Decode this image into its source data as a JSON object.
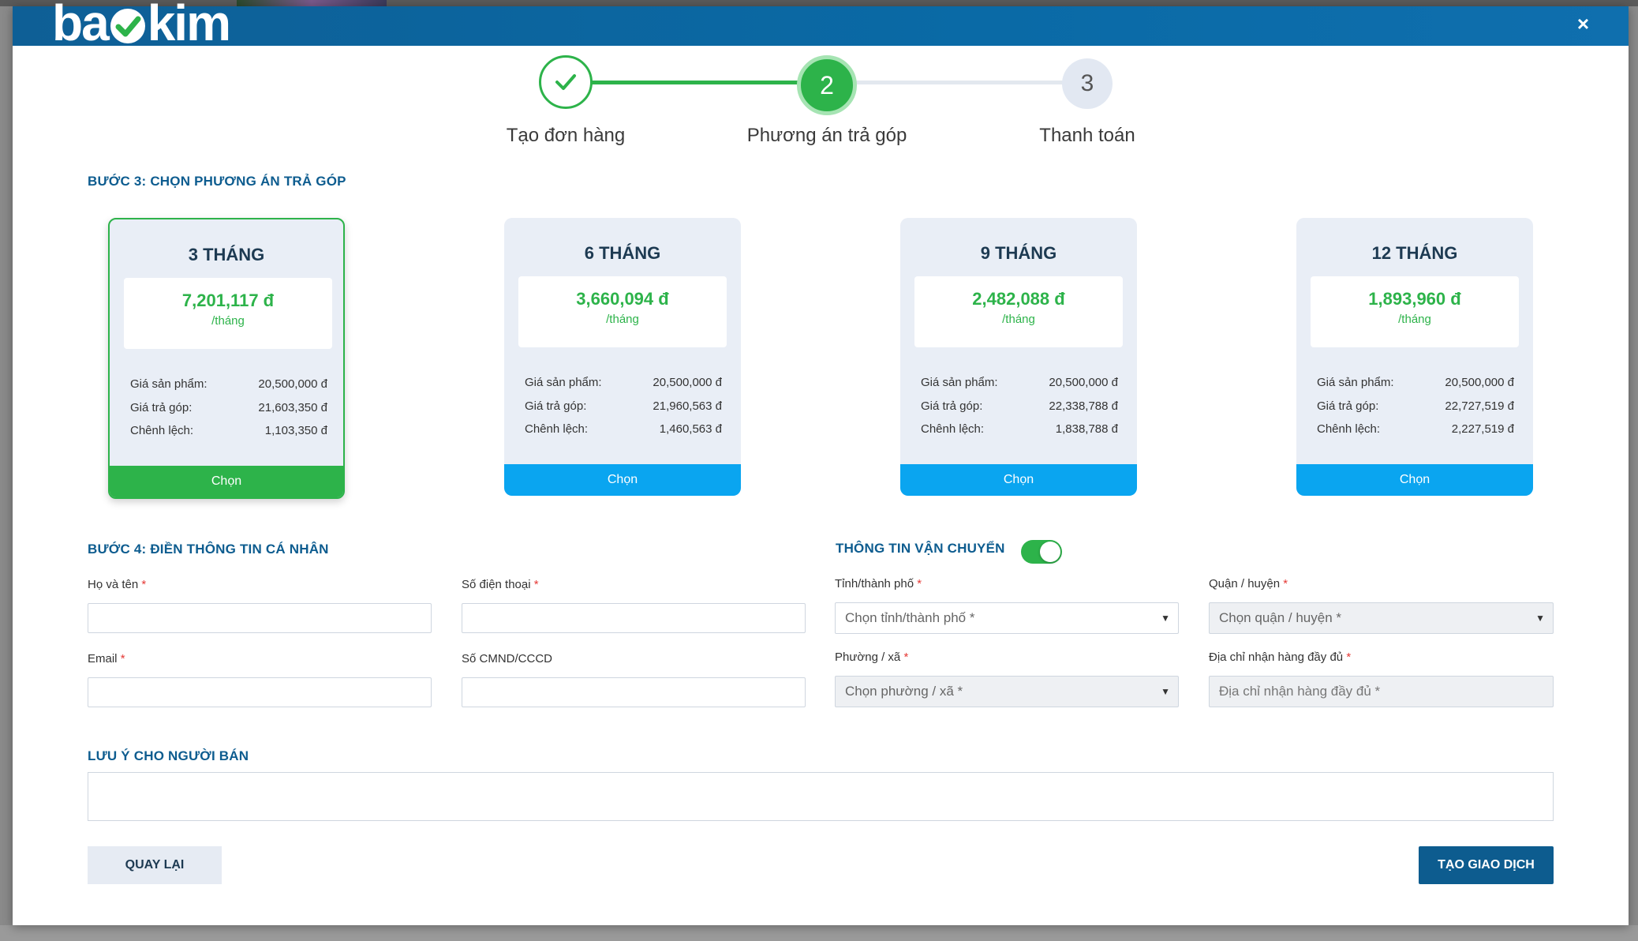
{
  "brand": {
    "logo_left": "ba",
    "logo_right": "kim"
  },
  "header": {
    "close_symbol": "×"
  },
  "stepper": {
    "steps": [
      {
        "label": "Tạo đơn hàng",
        "number": "",
        "status": "done"
      },
      {
        "label": "Phương án trả góp",
        "number": "2",
        "status": "active"
      },
      {
        "label": "Thanh toán",
        "number": "3",
        "status": "pending"
      }
    ]
  },
  "step3": {
    "title": "BƯỚC 3: CHỌN PHƯƠNG ÁN TRẢ GÓP",
    "row_labels": {
      "price": "Giá sản phẩm:",
      "installment": "Giá trả góp:",
      "difference": "Chênh lệch:"
    },
    "plans": [
      {
        "title": "3 THÁNG",
        "monthly": "7,201,117 đ",
        "unit": "/tháng",
        "price": "20,500,000 đ",
        "installment": "21,603,350 đ",
        "difference": "1,103,350 đ",
        "button": "Chọn",
        "selected": true
      },
      {
        "title": "6 THÁNG",
        "monthly": "3,660,094 đ",
        "unit": "/tháng",
        "price": "20,500,000 đ",
        "installment": "21,960,563 đ",
        "difference": "1,460,563 đ",
        "button": "Chọn",
        "selected": false
      },
      {
        "title": "9 THÁNG",
        "monthly": "2,482,088 đ",
        "unit": "/tháng",
        "price": "20,500,000 đ",
        "installment": "22,338,788 đ",
        "difference": "1,838,788 đ",
        "button": "Chọn",
        "selected": false
      },
      {
        "title": "12 THÁNG",
        "monthly": "1,893,960 đ",
        "unit": "/tháng",
        "price": "20,500,000 đ",
        "installment": "22,727,519 đ",
        "difference": "2,227,519 đ",
        "button": "Chọn",
        "selected": false
      }
    ]
  },
  "step4": {
    "title": "BƯỚC 4: ĐIỀN THÔNG TIN CÁ NHÂN",
    "full_name_label": "Họ và tên",
    "phone_label": "Số điện thoại",
    "email_label": "Email",
    "id_label": "Số CMND/CCCD",
    "required_mark": "*"
  },
  "shipping": {
    "title": "THÔNG TIN VẬN CHUYỂN",
    "toggle_on": true,
    "province_label": "Tỉnh/thành phố",
    "province_placeholder": "Chọn tỉnh/thành phố *",
    "district_label": "Quận / huyện",
    "district_placeholder": "Chọn quận / huyện *",
    "ward_label": "Phường / xã",
    "ward_placeholder": "Chọn phường / xã *",
    "address_label": "Địa chỉ nhận hàng đầy đủ",
    "address_placeholder": "Địa chỉ nhận hàng đầy đủ *"
  },
  "note": {
    "title": "LƯU Ý CHO NGƯỜI BÁN",
    "value": ""
  },
  "actions": {
    "back": "QUAY LẠI",
    "create": "TẠO GIAO DỊCH"
  },
  "colors": {
    "primary": "#0d5c8f",
    "green": "#2db34a",
    "blue_button": "#0aa5f0"
  }
}
